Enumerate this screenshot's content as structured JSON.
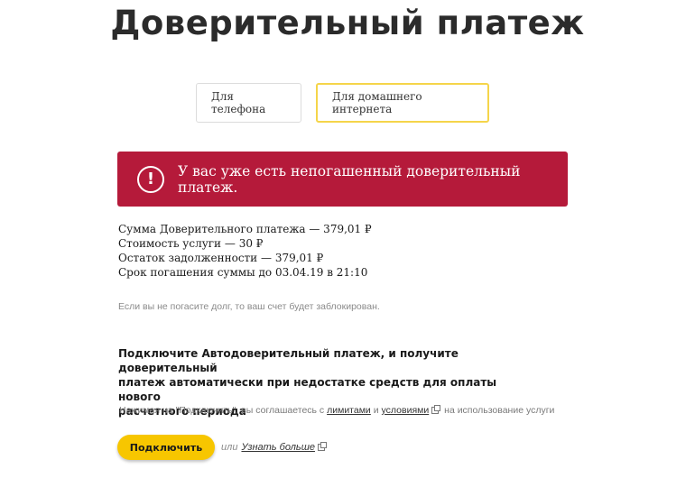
{
  "page": {
    "title": "Доверительный платеж"
  },
  "tabs": [
    {
      "label": "Для телефона",
      "active": false
    },
    {
      "label": "Для домашнего интернета",
      "active": true
    }
  ],
  "alert": {
    "icon": "!",
    "message": "У вас уже есть непогашенный доверительный платеж.",
    "color": "#b51a3a"
  },
  "details": [
    "Сумма Доверительного платежа — 379,01 ₽",
    "Стоимость услуги — 30 ₽",
    "Остаток задолженности — 379,01 ₽",
    "Срок погашения суммы до 03.04.19 в 21:10"
  ],
  "warning_note": "Если вы не погасите долг, то ваш счет будет заблокирован.",
  "promo": {
    "line1": "Подключите Автодоверительный платеж, и получите доверительный",
    "line2": "платеж автоматически при недостатке средств для оплаты нового",
    "line3": "расчетного периода"
  },
  "consent": {
    "prefix": "Нажимая на \"Подключить\", вы соглашаетесь с",
    "limits_link": "лимитами",
    "and": "и",
    "conditions_link": "условиями",
    "suffix": "на использование услуги"
  },
  "actions": {
    "connect_label": "Подключить",
    "or_text": "или",
    "learn_more_label": "Узнать больше",
    "accent_color": "#f7c600"
  }
}
